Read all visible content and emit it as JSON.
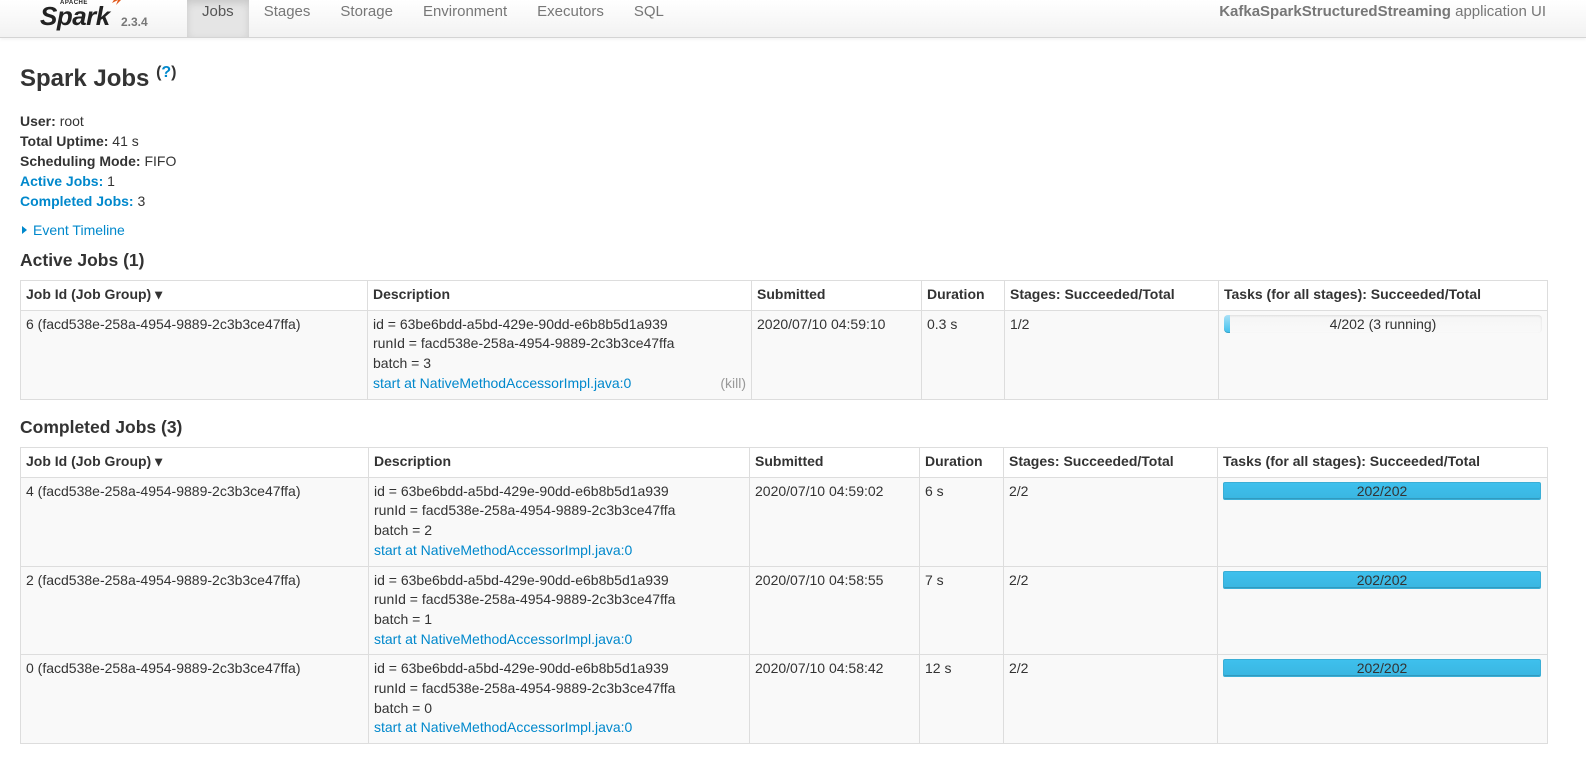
{
  "navbar": {
    "brand_small": "APACHE",
    "brand": "Spark",
    "version": "2.3.4",
    "tabs": [
      "Jobs",
      "Stages",
      "Storage",
      "Environment",
      "Executors",
      "SQL"
    ],
    "active_tab": "Jobs",
    "app_name": "KafkaSparkStructuredStreaming",
    "app_suffix": "application UI"
  },
  "page": {
    "title": "Spark Jobs",
    "help": "?",
    "summary": {
      "user_label": "User:",
      "user": "root",
      "uptime_label": "Total Uptime:",
      "uptime": "41 s",
      "mode_label": "Scheduling Mode:",
      "mode": "FIFO",
      "active_label": "Active Jobs:",
      "active": "1",
      "completed_label": "Completed Jobs:",
      "completed": "3"
    },
    "event_timeline": "Event Timeline"
  },
  "columns": [
    "Job Id (Job Group) ▾",
    "Description",
    "Submitted",
    "Duration",
    "Stages: Succeeded/Total",
    "Tasks (for all stages): Succeeded/Total"
  ],
  "active_jobs": {
    "title": "Active Jobs (1)",
    "rows": [
      {
        "job": "6 (facd538e-258a-4954-9889-2c3b3ce47ffa)",
        "desc_id": "id = 63be6bdd-a5bd-429e-90dd-e6b8b5d1a939",
        "desc_run": "runId = facd538e-258a-4954-9889-2c3b3ce47ffa",
        "desc_batch": "batch = 3",
        "desc_link": "start at NativeMethodAccessorImpl.java:0",
        "kill": "(kill)",
        "submitted": "2020/07/10 04:59:10",
        "duration": "0.3 s",
        "stages": "1/2",
        "tasks": "4/202 (3 running)",
        "tasks_fraction": 0.0198
      }
    ]
  },
  "completed_jobs": {
    "title": "Completed Jobs (3)",
    "rows": [
      {
        "job": "4 (facd538e-258a-4954-9889-2c3b3ce47ffa)",
        "desc_id": "id = 63be6bdd-a5bd-429e-90dd-e6b8b5d1a939",
        "desc_run": "runId = facd538e-258a-4954-9889-2c3b3ce47ffa",
        "desc_batch": "batch = 2",
        "desc_link": "start at NativeMethodAccessorImpl.java:0",
        "submitted": "2020/07/10 04:59:02",
        "duration": "6 s",
        "stages": "2/2",
        "tasks": "202/202",
        "tasks_fraction": 1
      },
      {
        "job": "2 (facd538e-258a-4954-9889-2c3b3ce47ffa)",
        "desc_id": "id = 63be6bdd-a5bd-429e-90dd-e6b8b5d1a939",
        "desc_run": "runId = facd538e-258a-4954-9889-2c3b3ce47ffa",
        "desc_batch": "batch = 1",
        "desc_link": "start at NativeMethodAccessorImpl.java:0",
        "submitted": "2020/07/10 04:58:55",
        "duration": "7 s",
        "stages": "2/2",
        "tasks": "202/202",
        "tasks_fraction": 1
      },
      {
        "job": "0 (facd538e-258a-4954-9889-2c3b3ce47ffa)",
        "desc_id": "id = 63be6bdd-a5bd-429e-90dd-e6b8b5d1a939",
        "desc_run": "runId = facd538e-258a-4954-9889-2c3b3ce47ffa",
        "desc_batch": "batch = 0",
        "desc_link": "start at NativeMethodAccessorImpl.java:0",
        "submitted": "2020/07/10 04:58:42",
        "duration": "12 s",
        "stages": "2/2",
        "tasks": "202/202",
        "tasks_fraction": 1
      }
    ]
  }
}
